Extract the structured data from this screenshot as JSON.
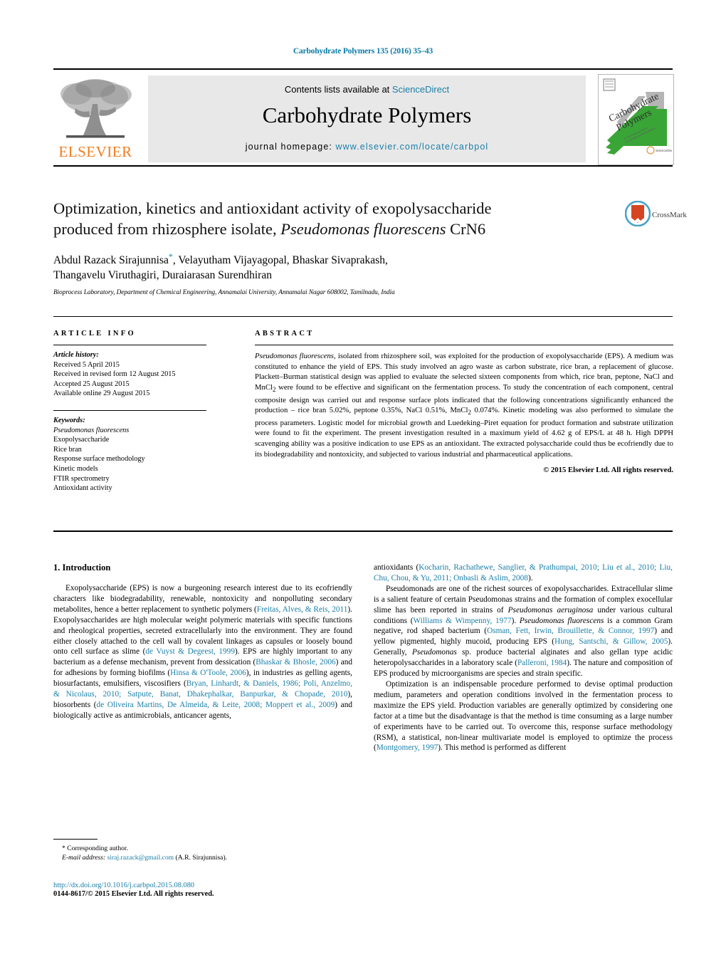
{
  "running_head": "Carbohydrate Polymers 135 (2016) 35–43",
  "masthead": {
    "contents_prefix": "Contents lists available at ",
    "sciencedirect": "ScienceDirect",
    "journal_title": "Carbohydrate Polymers",
    "homepage_prefix": "journal homepage: ",
    "homepage_url": "www.elsevier.com/locate/carbpol",
    "publisher_wordmark": "ELSEVIER",
    "cover_title_line1": "Carbohydrate",
    "cover_title_line2": "Polymers",
    "accent_color": "#1a7fa8",
    "elsevier_orange": "#F07D20",
    "cover_green": "#3aa537"
  },
  "article": {
    "title_line1": "Optimization, kinetics and antioxidant activity of exopolysaccharide",
    "title_line2_pre": "produced from rhizosphere isolate, ",
    "title_line2_italic": "Pseudomonas fluorescens",
    "title_line2_post": " CrN6",
    "authors_line1_a": "Abdul Razack Sirajunnisa",
    "authors_star": "*",
    "authors_line1_b": ", Velayutham Vijayagopal, Bhaskar Sivaprakash,",
    "authors_line2": "Thangavelu Viruthagiri, Duraiarasan Surendhiran",
    "affiliation": "Bioprocess Laboratory, Department of Chemical Engineering, Annamalai University, Annamalai Nagar 608002, Tamilnadu, India",
    "crossmark_label": "CrossMark"
  },
  "article_info": {
    "heading": "ARTICLE INFO",
    "history_label": "Article history:",
    "history": [
      "Received 5 April 2015",
      "Received in revised form 12 August 2015",
      "Accepted 25 August 2015",
      "Available online 29 August 2015"
    ],
    "keywords_label": "Keywords:",
    "keywords": [
      "Pseudomonas fluorescens",
      "Exopolysaccharide",
      "Rice bran",
      "Response surface methodology",
      "Kinetic models",
      "FTIR spectrometry",
      "Antioxidant activity"
    ]
  },
  "abstract": {
    "heading": "ABSTRACT",
    "lead_italic": "Pseudomonas fluorescens",
    "text_a": ", isolated from rhizosphere soil, was exploited for the production of exopolysaccharide (EPS). A medium was constituted to enhance the yield of EPS. This study involved an agro waste as carbon substrate, rice bran, a replacement of glucose. Plackett–Burman statistical design was applied to evaluate the selected sixteen components from which, rice bran, peptone, NaCl and MnCl",
    "sub_1": "2",
    "text_b": " were found to be effective and significant on the fermentation process. To study the concentration of each component, central composite design was carried out and response surface plots indicated that the following concentrations significantly enhanced the production – rice bran 5.02%, peptone 0.35%, NaCl 0.51%, MnCl",
    "sub_2": "2",
    "text_c": " 0.074%. Kinetic modeling was also performed to simulate the process parameters. Logistic model for microbial growth and Luedeking–Piret equation for product formation and substrate utilization were found to fit the experiment. The present investigation resulted in a maximum yield of 4.62 g of EPS/L at 48 h. High DPPH scavenging ability was a positive indication to use EPS as an antioxidant. The extracted polysaccharide could thus be ecofriendly due to its biodegradability and nontoxicity, and subjected to various industrial and pharmaceutical applications.",
    "copyright": "© 2015 Elsevier Ltd. All rights reserved."
  },
  "introduction": {
    "heading": "1.  Introduction",
    "left_p1_a": "Exopolysaccharide (EPS) is now a burgeoning research interest due to its ecofriendly characters like biodegradability, renewable, nontoxicity and nonpolluting secondary metabolites, hence a better replacement to synthetic polymers (",
    "left_p1_ref1": "Freitas, Alves, & Reis, 2011",
    "left_p1_b": "). Exopolysaccharides are high molecular weight polymeric materials with specific functions and rheological properties, secreted extracellularly into the environment. They are found either closely attached to the cell wall by covalent linkages as capsules or loosely bound onto cell surface as slime (",
    "left_p1_ref2": "de Vuyst & Degeest, 1999",
    "left_p1_c": "). EPS are highly important to any bacterium as a defense mechanism, prevent from dessication (",
    "left_p1_ref3": "Bhaskar & Bhosle, 2006",
    "left_p1_d": ") and for adhesions by forming biofilms (",
    "left_p1_ref4": "Hinsa & O'Toole, 2006",
    "left_p1_e": "), in industries as gelling agents, biosurfactants, emulsifiers, viscosifiers (",
    "left_p1_ref5": "Bryan, Linhardt, & Daniels, 1986; Poli, Anzelmo, & Nicolaus, 2010; Satpute, Banat, Dhakephalkar, Banpurkar, & Chopade, 2010",
    "left_p1_f": "), biosorbents (",
    "left_p1_ref6": "de Oliveira Martins, De Almeida, & Leite, 2008; Moppert et al., 2009",
    "left_p1_g": ") and biologically active as antimicrobials, anticancer agents,",
    "right_p1_a": "antioxidants (",
    "right_p1_ref1": "Kocharin, Rachathewe, Sanglier, & Prathumpai, 2010; Liu et al., 2010; Liu, Chu, Chou, & Yu, 2011; Onbasli & Aslim, 2008",
    "right_p1_b": ").",
    "right_p2_a": "Pseudomonads are one of the richest sources of exopolysaccharides. Extracellular slime is a salient feature of certain Pseudomonas strains and the formation of complex exocellular slime has been reported in strains of ",
    "right_p2_ital1": "Pseudomonas aeruginosa",
    "right_p2_b": " under various cultural conditions (",
    "right_p2_ref1": "Williams & Wimpenny, 1977",
    "right_p2_c": "). ",
    "right_p2_ital2": "Pseudomonas fluorescens",
    "right_p2_d": " is a common Gram negative, rod shaped bacterium (",
    "right_p2_ref2": "Osman, Fett, Irwin, Brouillette, & Connor, 1997",
    "right_p2_e": ") and yellow pigmented, highly mucoid, producing EPS (",
    "right_p2_ref3": "Hung, Santschi, & Gillow, 2005",
    "right_p2_f": "). Generally, ",
    "right_p2_ital3": "Pseudomonas",
    "right_p2_g": " sp. produce bacterial alginates and also gellan type acidic heteropolysaccharides in a laboratory scale (",
    "right_p2_ref4": "Palleroni, 1984",
    "right_p2_h": "). The nature and composition of EPS produced by microorganisms are species and strain specific.",
    "right_p3_a": "Optimization is an indispensable procedure performed to devise optimal production medium, parameters and operation conditions involved in the fermentation process to maximize the EPS yield. Production variables are generally optimized by considering one factor at a time but the disadvantage is that the method is time consuming as a large number of experiments have to be carried out. To overcome this, response surface methodology (RSM), a statistical, non-linear multivariate model is employed to optimize the process (",
    "right_p3_ref1": "Montgomery, 1997",
    "right_p3_b": "). This method is performed as different"
  },
  "footnote": {
    "corresponding": "* Corresponding author.",
    "email_label": "E-mail address:",
    "email": "siraj.razack@gmail.com",
    "email_suffix": " (A.R. Sirajunnisa)."
  },
  "footer": {
    "doi": "http://dx.doi.org/10.1016/j.carbpol.2015.08.080",
    "issn": "0144-8617/© 2015 Elsevier Ltd. All rights reserved."
  }
}
